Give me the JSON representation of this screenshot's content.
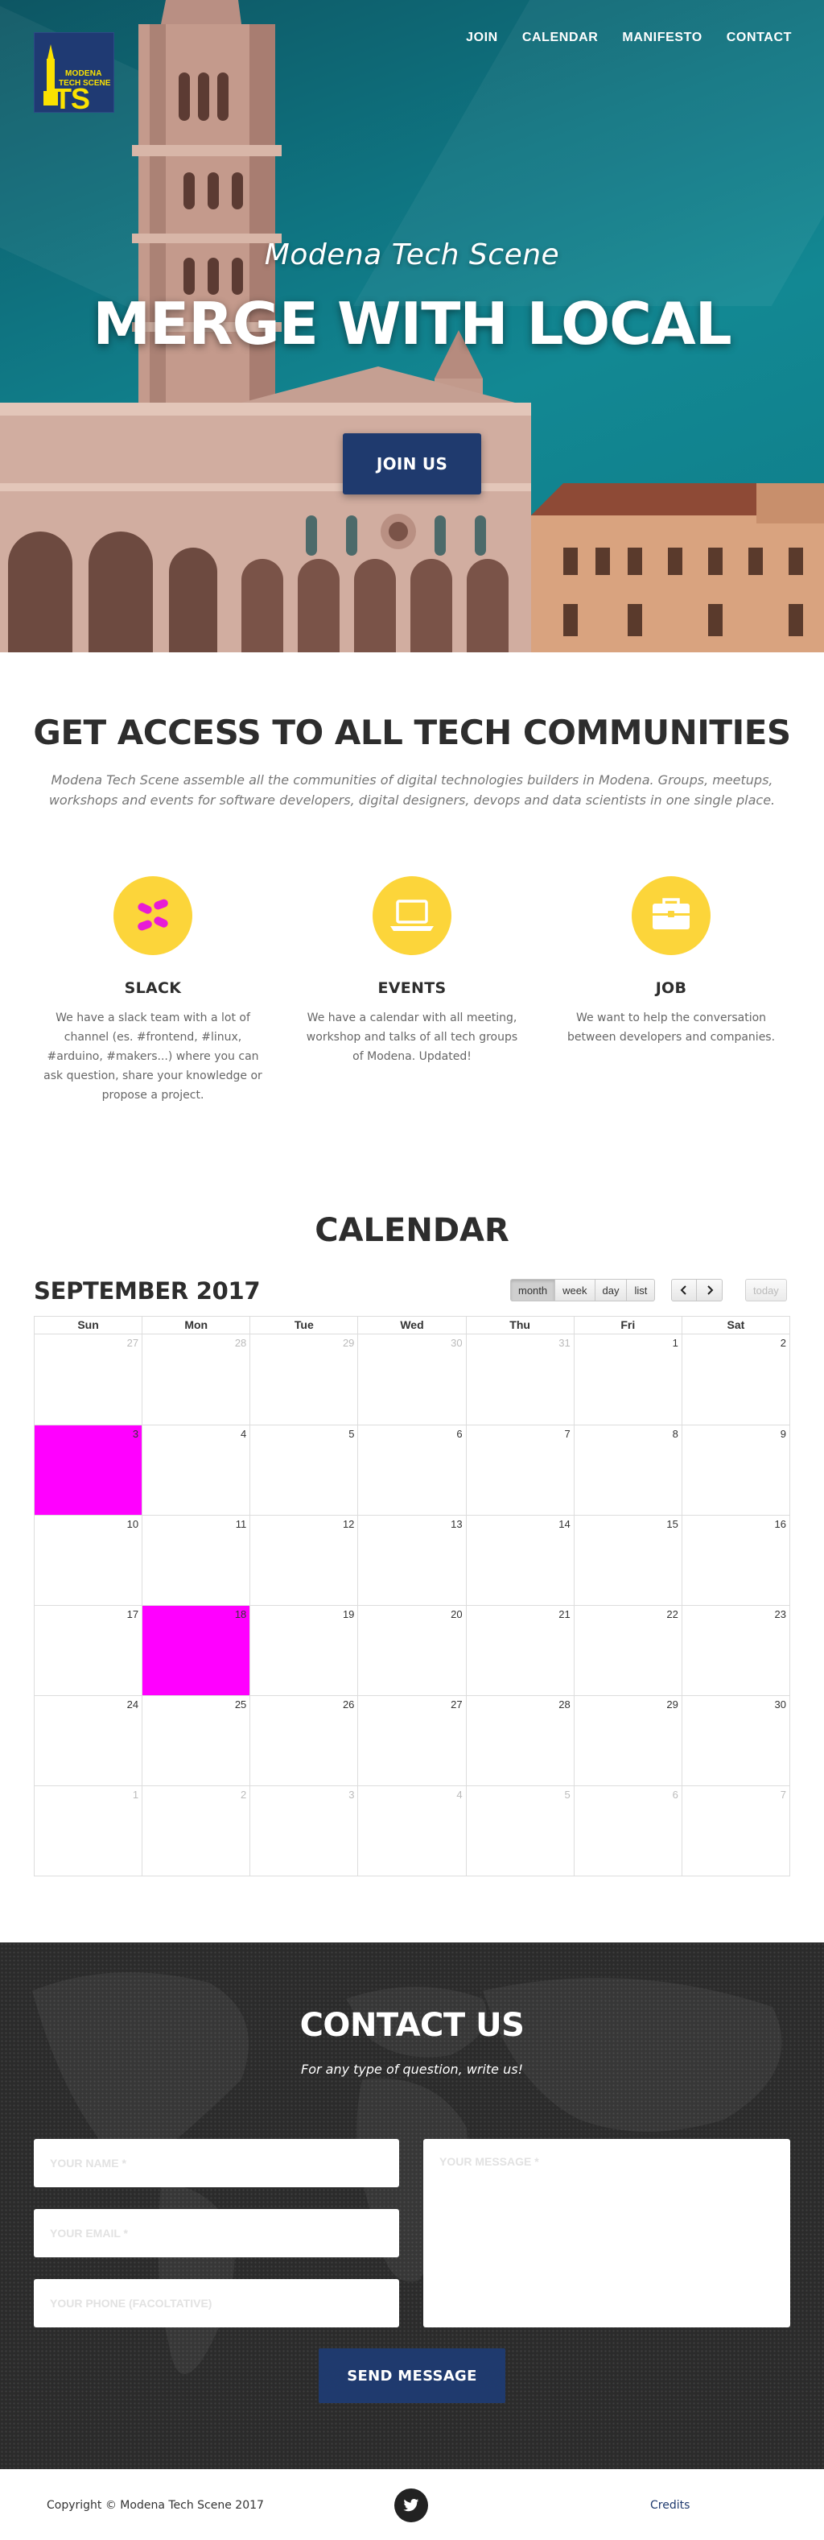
{
  "colors": {
    "brand_blue": "#1f3a6e",
    "accent_yellow": "#fcd53a",
    "event_magenta": "#ff00ff",
    "hero_teal": "#0f7481",
    "contact_dark": "#2b2b2b"
  },
  "logo": {
    "line1": "MODENA",
    "line2": "TECH SCENE",
    "mark": "TS"
  },
  "nav": [
    {
      "label": "JOIN"
    },
    {
      "label": "CALENDAR"
    },
    {
      "label": "MANIFESTO"
    },
    {
      "label": "CONTACT"
    }
  ],
  "hero": {
    "subtitle": "Modena Tech Scene",
    "title": "MERGE WITH LOCAL",
    "cta": "JOIN US"
  },
  "about": {
    "title": "GET ACCESS TO ALL TECH COMMUNITIES",
    "intro": "Modena Tech Scene assemble all the communities of digital technologies builders in Modena. Groups, meetups, workshops and events for software developers, digital designers, devops and data scientists in one single place."
  },
  "features": [
    {
      "icon": "slack-icon",
      "title": "SLACK",
      "text": "We have a slack team with a lot of channel (es. #frontend, #linux, #arduino, #makers...) where you can ask question, share your knowledge or propose a project."
    },
    {
      "icon": "laptop-icon",
      "title": "EVENTS",
      "text": "We have a calendar with all meeting, workshop and talks of all tech groups of Modena. Updated!"
    },
    {
      "icon": "briefcase-icon",
      "title": "JOB",
      "text": "We want to help the conversation between developers and companies."
    }
  ],
  "calendar": {
    "section_title": "CALENDAR",
    "month_title": "SEPTEMBER 2017",
    "views": [
      "month",
      "week",
      "day",
      "list"
    ],
    "active_view": "month",
    "prev_icon": "chevron-left-icon",
    "next_icon": "chevron-right-icon",
    "today_label": "today",
    "weekdays": [
      "Sun",
      "Mon",
      "Tue",
      "Wed",
      "Thu",
      "Fri",
      "Sat"
    ],
    "weeks": [
      [
        {
          "d": "27",
          "other": true
        },
        {
          "d": "28",
          "other": true
        },
        {
          "d": "29",
          "other": true
        },
        {
          "d": "30",
          "other": true
        },
        {
          "d": "31",
          "other": true
        },
        {
          "d": "1"
        },
        {
          "d": "2"
        }
      ],
      [
        {
          "d": "3",
          "event": true
        },
        {
          "d": "4"
        },
        {
          "d": "5"
        },
        {
          "d": "6"
        },
        {
          "d": "7"
        },
        {
          "d": "8"
        },
        {
          "d": "9"
        }
      ],
      [
        {
          "d": "10"
        },
        {
          "d": "11"
        },
        {
          "d": "12"
        },
        {
          "d": "13"
        },
        {
          "d": "14"
        },
        {
          "d": "15"
        },
        {
          "d": "16"
        }
      ],
      [
        {
          "d": "17"
        },
        {
          "d": "18",
          "event": true
        },
        {
          "d": "19"
        },
        {
          "d": "20"
        },
        {
          "d": "21"
        },
        {
          "d": "22"
        },
        {
          "d": "23"
        }
      ],
      [
        {
          "d": "24"
        },
        {
          "d": "25"
        },
        {
          "d": "26"
        },
        {
          "d": "27"
        },
        {
          "d": "28"
        },
        {
          "d": "29"
        },
        {
          "d": "30"
        }
      ],
      [
        {
          "d": "1",
          "other": true
        },
        {
          "d": "2",
          "other": true
        },
        {
          "d": "3",
          "other": true
        },
        {
          "d": "4",
          "other": true
        },
        {
          "d": "5",
          "other": true
        },
        {
          "d": "6",
          "other": true
        },
        {
          "d": "7",
          "other": true
        }
      ]
    ]
  },
  "contact": {
    "title": "CONTACT US",
    "subtitle": "For any type of question, write us!",
    "name_placeholder": "YOUR NAME *",
    "email_placeholder": "YOUR EMAIL *",
    "phone_placeholder": "YOUR PHONE (FACOLTATIVE)",
    "message_placeholder": "YOUR MESSAGE *",
    "send_label": "SEND MESSAGE"
  },
  "footer": {
    "copyright": "Copyright © Modena Tech Scene 2017",
    "social_icon": "twitter-icon",
    "credits": "Credits"
  }
}
